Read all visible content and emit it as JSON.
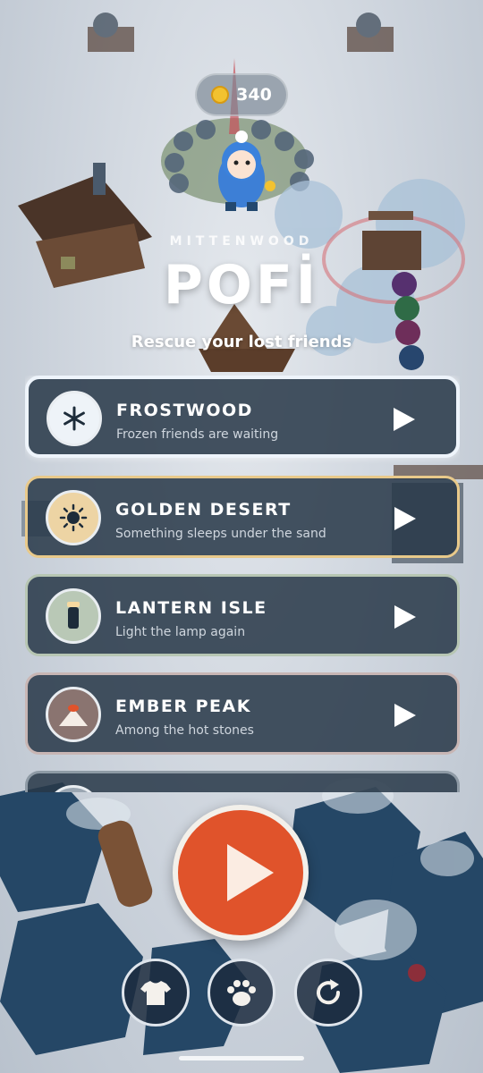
{
  "hud": {
    "coins": "340",
    "coin_icon": "coin-icon"
  },
  "header": {
    "world": "MITTENWOOD",
    "title": "POFİ",
    "tagline": "Rescue your lost friends"
  },
  "levels": [
    {
      "title": "FROSTWOOD",
      "subtitle": "Frozen friends are waiting",
      "icon": "snowflake-icon",
      "selected": true
    },
    {
      "title": "GOLDEN DESERT",
      "subtitle": "Something sleeps under the sand",
      "icon": "sun-icon"
    },
    {
      "title": "LANTERN ISLE",
      "subtitle": "Light the lamp again",
      "icon": "lantern-icon"
    },
    {
      "title": "EMBER PEAK",
      "subtitle": "Among the hot stones",
      "icon": "volcano-icon"
    }
  ],
  "actions": {
    "play": "play-icon",
    "buttons": [
      "shirt-icon",
      "paw-icon",
      "restart-icon"
    ]
  },
  "colors": {
    "accent": "#e0532b",
    "panel": "#283848",
    "coin": "#f2c230"
  }
}
